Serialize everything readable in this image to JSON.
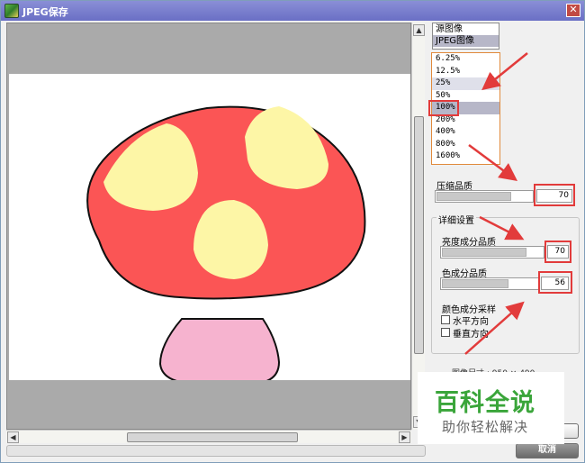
{
  "window": {
    "title": "JPEG保存",
    "close_glyph": "✕"
  },
  "source_list": {
    "items": [
      "源图像",
      "JPEG图像"
    ],
    "selected_index": 1
  },
  "zoom_list": {
    "items": [
      "6.25%",
      "12.5%",
      "25%",
      "50%",
      "100%",
      "200%",
      "400%",
      "800%",
      "1600%"
    ],
    "hover": "25%",
    "selected": "100%"
  },
  "compression": {
    "label": "压缩品质",
    "value": "70",
    "fill_fraction": 0.78
  },
  "details": {
    "heading": "详细设置",
    "luminance_label": "亮度成分品质",
    "luminance_value": "70",
    "luminance_fill_fraction": 0.84,
    "chroma_label": "色成分品质",
    "chroma_value": "56",
    "chroma_fill_fraction": 0.7,
    "sampling_label": "颜色成分采样",
    "horizontal_label": "水平方向",
    "vertical_label": "垂直方向",
    "horizontal_checked": false,
    "vertical_checked": false
  },
  "image_info_partial": "图像尺寸 : 950 × 490",
  "buttons": {
    "cancel": "取消",
    "ok": ""
  },
  "watermark": {
    "main": "百科全说",
    "sub": "助你轻松解决"
  },
  "colors": {
    "annotation_red": "#e23b3b",
    "mushroom_cap": "#fb5555",
    "mushroom_spots": "#fdf6a6",
    "mushroom_stem": "#f6b3cf",
    "watermark_green": "#3aa53a"
  },
  "icons": {
    "app": "app-icon",
    "close": "close-icon",
    "scroll_up": "▲",
    "scroll_down": "▼",
    "scroll_left": "◀",
    "scroll_right": "▶"
  }
}
